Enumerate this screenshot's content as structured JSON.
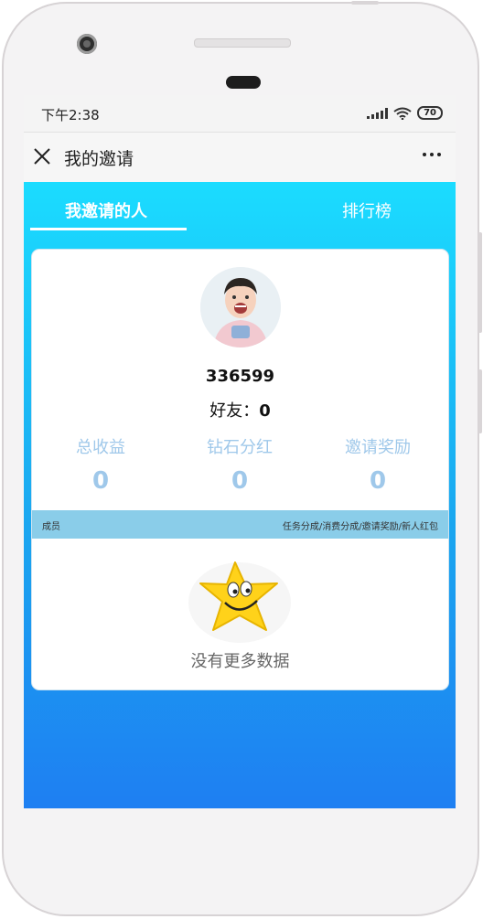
{
  "status_bar": {
    "time": "下午2:38",
    "battery": "70"
  },
  "title_bar": {
    "title": "我的邀请"
  },
  "tabs": [
    {
      "label": "我邀请的人",
      "active": true
    },
    {
      "label": "排行榜",
      "active": false
    }
  ],
  "profile": {
    "user_id": "336599",
    "friends_label": "好友：",
    "friends_count": "0"
  },
  "stats": [
    {
      "label": "总收益",
      "value": "0"
    },
    {
      "label": "钻石分红",
      "value": "0"
    },
    {
      "label": "邀请奖励",
      "value": "0"
    }
  ],
  "member_bar": {
    "left": "成员",
    "right": "任务分成/消费分成/邀请奖励/新人红包"
  },
  "empty_state": {
    "text": "没有更多数据"
  },
  "colors": {
    "accent_top": "#1bdcff",
    "accent_bottom": "#1e7ff2",
    "stat_text": "#9fc8ea",
    "member_bar": "#8acde9"
  }
}
